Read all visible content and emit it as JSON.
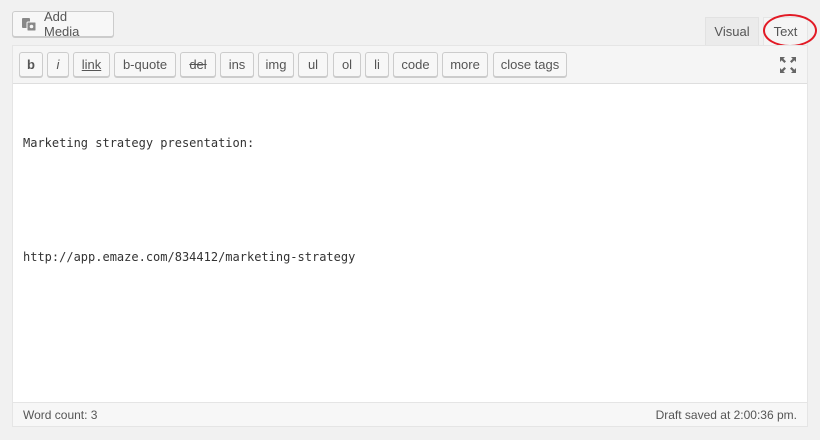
{
  "media_button": {
    "label": "Add Media",
    "icon": "add-media-icon"
  },
  "tabs": {
    "visual": "Visual",
    "text": "Text"
  },
  "toolbar": {
    "buttons": [
      "b",
      "i",
      "link",
      "b-quote",
      "del",
      "ins",
      "img",
      "ul",
      "ol",
      "li",
      "code",
      "more",
      "close tags"
    ],
    "fullscreen_icon": "fullscreen-icon"
  },
  "editor": {
    "line1": "Marketing strategy presentation:",
    "line2": "",
    "line3": "http://app.emaze.com/834412/marketing-strategy"
  },
  "status": {
    "word_count": "Word count: 3",
    "draft_saved": "Draft saved at 2:00:36 pm."
  },
  "colors": {
    "highlight": "#e21a25"
  }
}
